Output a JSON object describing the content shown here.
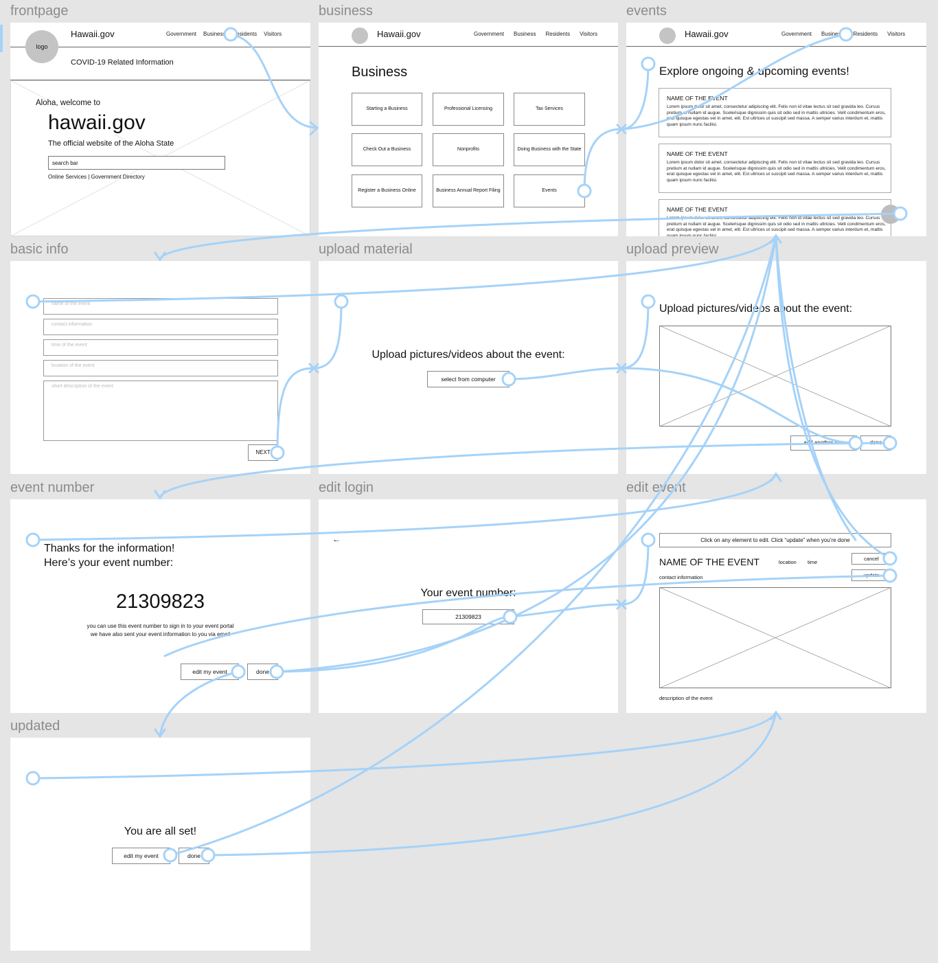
{
  "frames": {
    "frontpage": {
      "label": "frontpage",
      "brand": "Hawaii.gov",
      "logo": "logo",
      "nav": [
        "Government",
        "Business",
        "Residents",
        "Visitors"
      ],
      "covid": "COVID-19 Related Information",
      "welcome": "Aloha, welcome to",
      "site": "hawaii.gov",
      "tagline": "The official website of the Aloha State",
      "search_placeholder": "search bar",
      "links": "Online Services | Government Directory"
    },
    "business": {
      "label": "business",
      "brand": "Hawaii.gov",
      "nav": [
        "Government",
        "Business",
        "Residents",
        "Visitors"
      ],
      "title": "Business",
      "tiles": [
        "Starting a Business",
        "Professional Licensing",
        "Tax Services",
        "Check Out a Business",
        "Nonprofits",
        "Doing Business with the State",
        "Register a Business Online",
        "Business Annual Report Filing",
        "Events"
      ]
    },
    "events": {
      "label": "events",
      "brand": "Hawaii.gov",
      "nav": [
        "Government",
        "Business",
        "Residents",
        "Visitors"
      ],
      "title": "Explore ongoing & upcoming events!",
      "cards": [
        {
          "name": "NAME OF THE EVENT",
          "text": "Lorem ipsum dolor sit amet, consectetur adipiscing elit. Felis non id vitae lectus sit sed gravida leo. Cursus pretium at nullam id augue. Scelerisque dignissim quis sit odio sed in mattis ultricies. Velit condimentum eros, erat quisque egestas vel in amet, elit. Est ultrices ut suscipit sed massa. A semper varius interdum et, mattis quam ipsum nunc facilisi."
        },
        {
          "name": "NAME OF THE EVENT",
          "text": "Lorem ipsum dolor sit amet, consectetur adipiscing elit. Felis non id vitae lectus sit sed gravida leo. Cursus pretium at nullam id augue. Scelerisque dignissim quis sit odio sed in mattis ultricies. Velit condimentum eros, erat quisque egestas vel in amet, elit. Est ultrices ut suscipit sed massa. A semper varius interdum et, mattis quam ipsum nunc facilisi."
        },
        {
          "name": "NAME OF THE EVENT",
          "text": "Lorem ipsum dolor sit amet, consectetur adipiscing elit. Felis non id vitae lectus sit sed gravida leo. Cursus pretium at nullam id augue. Scelerisque dignissim quis sit odio sed in mattis ultricies. Velit condimentum eros, erat quisque egestas vel in amet, elit. Est ultrices ut suscipit sed massa. A semper varius interdum et, mattis quam ipsum nunc facilisi."
        }
      ]
    },
    "basic_info": {
      "label": "basic info",
      "fields": [
        "name of the event",
        "contact information",
        "time of the event",
        "location of the event",
        "short description of the event"
      ],
      "next": "NEXT"
    },
    "upload_material": {
      "label": "upload material",
      "prompt": "Upload pictures/videos about the event:",
      "select": "select from computer"
    },
    "upload_preview": {
      "label": "upload preview",
      "prompt": "Upload pictures/videos about the event:",
      "add_another": "add another one",
      "done": "done"
    },
    "event_number": {
      "label": "event number",
      "thanks_1": "Thanks for the information!",
      "thanks_2": "Here’s your event number:",
      "number": "21309823",
      "note_1": "you can use this event number to sign in to your event portal",
      "note_2": "we have also sent your event information to you via email",
      "edit": "edit my event",
      "done": "done"
    },
    "edit_login": {
      "label": "edit login",
      "back": "←",
      "prompt": "Your event number:",
      "number": "21309823"
    },
    "edit_event": {
      "label": "edit event",
      "hint": "Click on any element to edit. Click “update” when you’re done",
      "name": "NAME OF THE EVENT",
      "location": "location",
      "time": "time",
      "contact": "contact information",
      "cancel": "cancel",
      "update": "update",
      "description": "description of the event"
    },
    "updated": {
      "label": "updated",
      "message": "You are all set!",
      "edit": "edit my event",
      "done": "done"
    }
  },
  "colors": {
    "canvas": "#e5e5e5",
    "link": "#a5d2f8",
    "label": "#8c8c8c"
  }
}
